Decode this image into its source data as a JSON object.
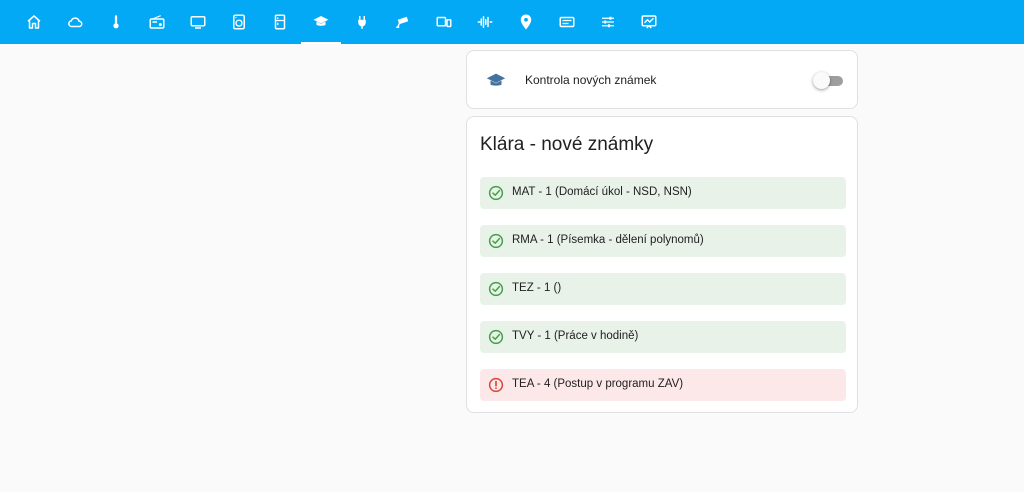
{
  "nav": {
    "tabs": [
      {
        "icon": "home-icon",
        "active": false
      },
      {
        "icon": "cloud-icon",
        "active": false
      },
      {
        "icon": "thermometer-icon",
        "active": false
      },
      {
        "icon": "radio-icon",
        "active": false
      },
      {
        "icon": "television-icon",
        "active": false
      },
      {
        "icon": "washing-machine-icon",
        "active": false
      },
      {
        "icon": "fridge-icon",
        "active": false
      },
      {
        "icon": "school-icon",
        "active": true
      },
      {
        "icon": "outlet-icon",
        "active": false
      },
      {
        "icon": "cctv-icon",
        "active": false
      },
      {
        "icon": "devices-icon",
        "active": false
      },
      {
        "icon": "waveform-icon",
        "active": false
      },
      {
        "icon": "map-marker-icon",
        "active": false
      },
      {
        "icon": "router-icon",
        "active": false
      },
      {
        "icon": "tune-icon",
        "active": false
      },
      {
        "icon": "monitor-dashboard-icon",
        "active": false
      }
    ]
  },
  "toggle_card": {
    "icon": "school-icon",
    "label": "Kontrola nových známek",
    "enabled": false
  },
  "grades_card": {
    "title": "Klára - nové známky",
    "items": [
      {
        "text": "MAT - 1 (Domácí úkol - NSD, NSN)",
        "status": "ok",
        "icon": "check-circle-icon"
      },
      {
        "text": "RMA - 1 (Písemka - dělení polynomů)",
        "status": "ok",
        "icon": "check-circle-icon"
      },
      {
        "text": "TEZ - 1 ()",
        "status": "ok",
        "icon": "check-circle-icon"
      },
      {
        "text": "TVY - 1 (Práce v hodině)",
        "status": "ok",
        "icon": "check-circle-icon"
      },
      {
        "text": "TEA - 4 (Postup v programu ZAV)",
        "status": "bad",
        "icon": "alert-circle-icon"
      }
    ]
  },
  "colors": {
    "header": "#03a9f4",
    "ok_icon": "#43a047",
    "ok_bg": "#e8f2e9",
    "bad_icon": "#db4437",
    "bad_bg": "#fce8e8",
    "card_icon": "#44739e"
  }
}
